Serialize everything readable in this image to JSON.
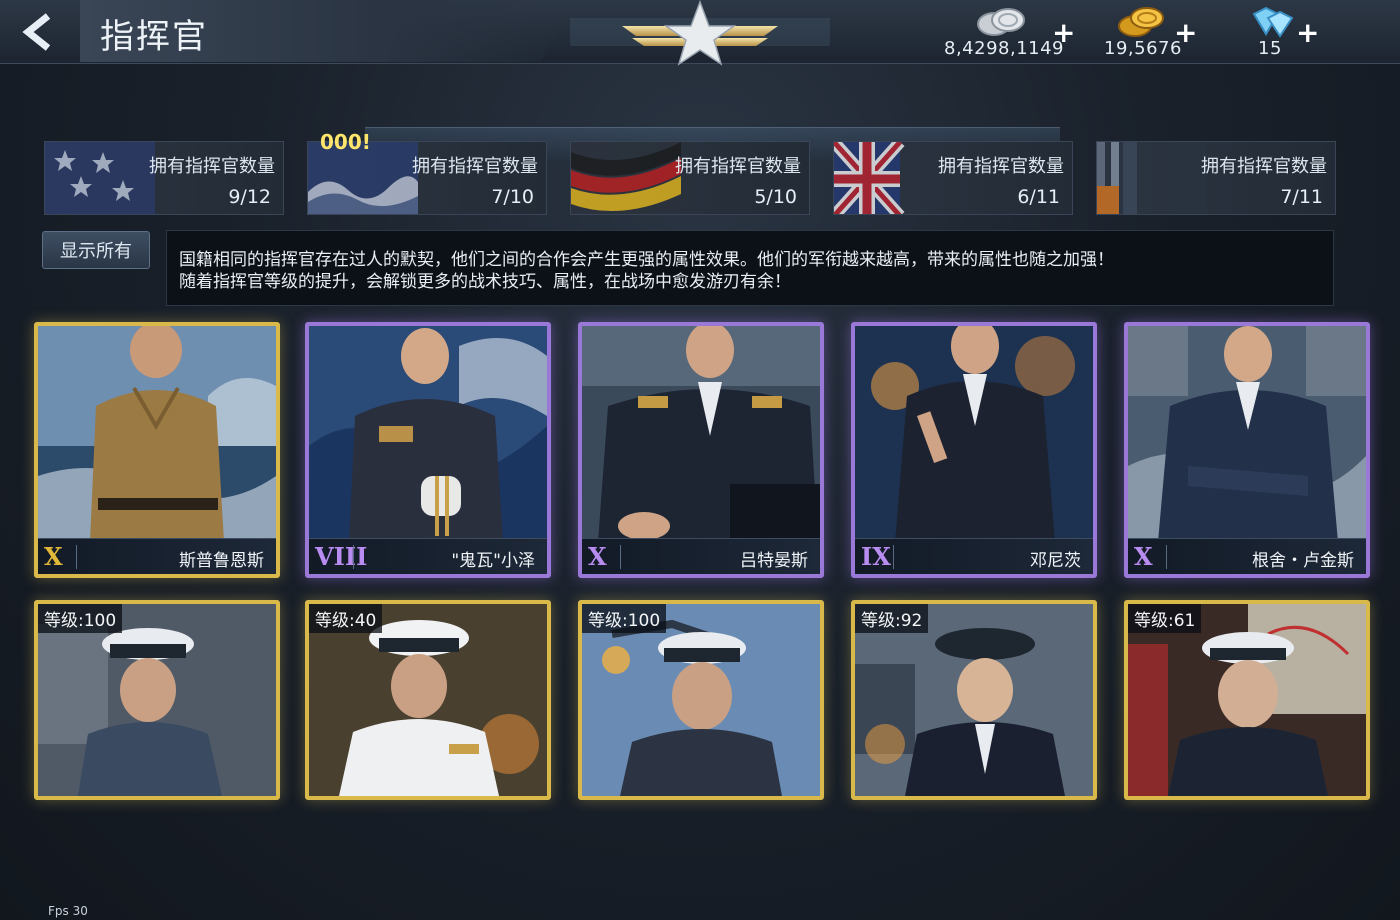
{
  "header": {
    "title": "指挥官",
    "currencies": [
      {
        "name": "silver",
        "value": "8,4298,1149"
      },
      {
        "name": "gold",
        "value": "19,5676"
      },
      {
        "name": "diamond",
        "value": "15"
      }
    ],
    "plus": "+"
  },
  "nations": {
    "scan_tag": "000!",
    "items": [
      {
        "flag": "usa",
        "label": "拥有指挥官数量",
        "count": "9/12"
      },
      {
        "flag": "japan",
        "label": "拥有指挥官数量",
        "count": "7/10"
      },
      {
        "flag": "germany",
        "label": "拥有指挥官数量",
        "count": "5/10"
      },
      {
        "flag": "uk",
        "label": "拥有指挥官数量",
        "count": "6/11"
      },
      {
        "flag": "other",
        "label": "拥有指挥官数量",
        "count": "7/11"
      }
    ]
  },
  "show_all": "显示所有",
  "description": {
    "line1": "国籍相同的指挥官存在过人的默契，他们之间的合作会产生更强的属性效果。他们的军衔越来越高，带来的属性也随之加强！",
    "line2": "随着指挥官等级的提升，会解锁更多的战术技巧、属性，在战场中愈发游刃有余！"
  },
  "commanders_row1": [
    {
      "rank": "X",
      "name": "斯普鲁恩斯",
      "frame": "gold"
    },
    {
      "rank": "VIII",
      "name": "\"鬼瓦\"小泽",
      "frame": "purple"
    },
    {
      "rank": "X",
      "name": "吕特晏斯",
      "frame": "purple"
    },
    {
      "rank": "IX",
      "name": "邓尼茨",
      "frame": "purple"
    },
    {
      "rank": "X",
      "name": "根舍・卢金斯",
      "frame": "purple"
    }
  ],
  "commanders_row2": [
    {
      "level": "等级:100"
    },
    {
      "level": "等级:40"
    },
    {
      "level": "等级:100"
    },
    {
      "level": "等级:92"
    },
    {
      "level": "等级:61"
    }
  ],
  "fps": "Fps 30",
  "colors": {
    "gold_frame": "#d9b94a",
    "purple_frame": "#9a78d8",
    "background": "#1a212b"
  }
}
